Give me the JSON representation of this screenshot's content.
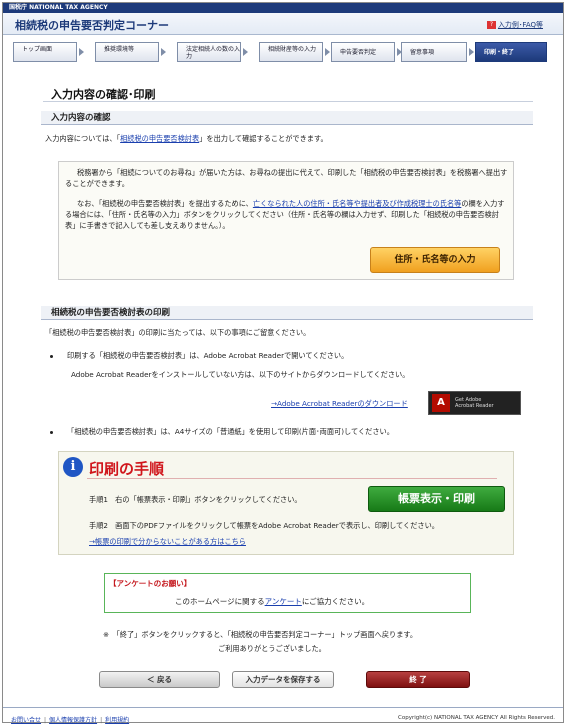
{
  "agency_label": "国税庁 NATIONAL TAX AGENCY",
  "header": {
    "title": "相続税の申告要否判定コーナー",
    "help_label": "入力例･FAQ等"
  },
  "steps": [
    {
      "label": "トップ画面"
    },
    {
      "label": "推奨環境等"
    },
    {
      "label": "法定相続人の数の入力"
    },
    {
      "label": "相続財産等の入力"
    },
    {
      "label": "申告要否判定"
    },
    {
      "label": "留意事項"
    },
    {
      "label": "印刷・終了"
    }
  ],
  "page_title": "入力内容の確認･印刷",
  "section1": {
    "heading": "入力内容の確認",
    "intro_prefix": "入力内容については、「",
    "intro_link": "相続税の申告要否検討表",
    "intro_suffix": "」を出力して確認することができます。",
    "box_p1": "税務署から「相続についてのお尋ね」が届いた方は、お尋ねの提出に代えて、印刷した「相続税の申告要否検討表」を税務署へ提出することができます。",
    "box_p2_prefix": "なお、「相続税の申告要否検討表」を提出するために、",
    "box_p2_link": "亡くなられた人の住所・氏名等や提出者及び作成税理士の氏名等",
    "box_p2_suffix": "の欄を入力する場合には、「住所・氏名等の入力」ボタンをクリックしてください（住所・氏名等の欄は入力せず、印刷した「相続税の申告要否検討表」に手書きで記入しても差し支えありません。）。",
    "address_button": "住所・氏名等の入力"
  },
  "section2": {
    "heading": "相続税の申告要否検討表の印刷",
    "intro": "「相続税の申告要否検討表」の印刷に当たっては、以下の事項にご留意ください。",
    "bullet1": "印刷する「相続税の申告要否検討表」は、Adobe Acrobat Readerで開いてください。",
    "bullet1_sub": "Adobe Acrobat Readerをインストールしていない方は、以下のサイトからダウンロードしてください。",
    "download_link": "→Adobe Acrobat Readerのダウンロード",
    "adobe_badge_line1": "Get Adobe",
    "adobe_badge_line2": "Acrobat Reader",
    "bullet2": "「相続税の申告要否検討表」は、A4サイズの「普通紙」を使用して印刷(片面･両面可)してください。"
  },
  "procedure": {
    "title": "印刷の手順",
    "step1": "手順1　右の「帳票表示・印刷」ボタンをクリックしてください。",
    "step2": "手順2　画面下のPDFファイルをクリックして帳票をAdobe Acrobat Readerで表示し、印刷してください。",
    "help_link": "→帳票の印刷で分からないことがある方はこちら",
    "print_button": "帳票表示・印刷"
  },
  "survey": {
    "heading": "【アンケートのお願い】",
    "text_prefix": "このホームページに関する",
    "text_link": "アンケート",
    "text_suffix": "にご協力ください。"
  },
  "note1": "※　「終了」ボタンをクリックすると、「相続税の申告要否判定コーナー」トップ画面へ戻ります。",
  "note2": "ご利用ありがとうございました。",
  "buttons": {
    "back": "＜ 戻る",
    "save": "入力データを保存する",
    "end": "終 了"
  },
  "footer": {
    "links": [
      "お問い合せ",
      "個人情報保護方針",
      "利用規約"
    ],
    "copyright": "Copyright(c) NATIONAL TAX AGENCY All Rights Reserved."
  }
}
